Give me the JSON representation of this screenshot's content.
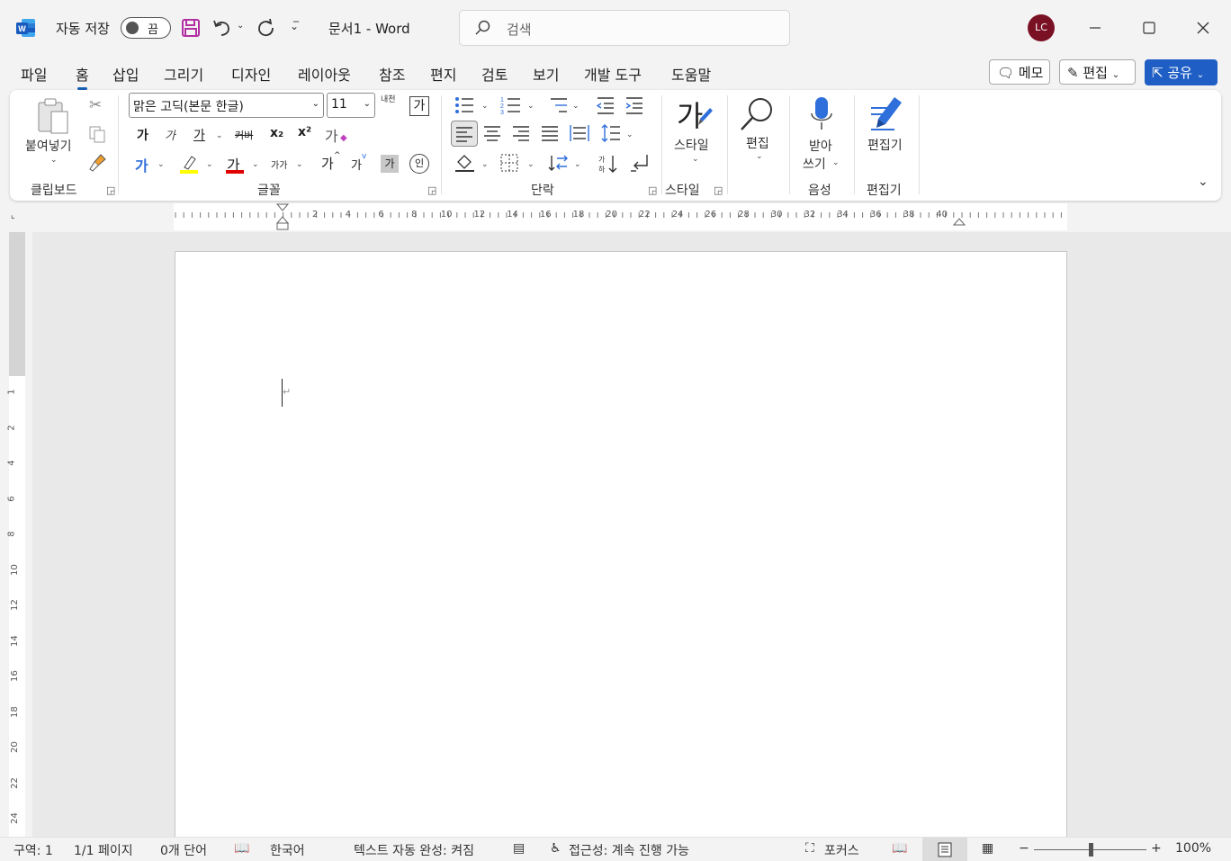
{
  "title_bar": {
    "autosave_label": "자동 저장",
    "autosave_state": "끔",
    "doc_title": "문서1  -  Word",
    "search_placeholder": "검색",
    "avatar_initials": "LC"
  },
  "tabs": [
    "파일",
    "홈",
    "삽입",
    "그리기",
    "디자인",
    "레이아웃",
    "참조",
    "편지",
    "검토",
    "보기",
    "개발 도구",
    "도움말"
  ],
  "active_tab": "홈",
  "tab_actions": {
    "memo": "메모",
    "edit": "편집",
    "share": "공유"
  },
  "ribbon": {
    "clipboard": {
      "paste": "붙여넣기",
      "label": "클립보드"
    },
    "font": {
      "font_name": "맑은 고딕(본문 한글)",
      "font_size": "11",
      "bold": "가",
      "italic": "가",
      "underline": "가",
      "strike": "커버",
      "subscript": "x₂",
      "superscript": "x²",
      "clear": "가",
      "phonetic": "내천",
      "charborder": "가",
      "texteffect": "가",
      "fontcolor": "가",
      "charscale": "가가",
      "grow": "가",
      "shrink": "가",
      "shading": "가",
      "enclose": "인",
      "label": "글꼴"
    },
    "paragraph": {
      "label": "단락"
    },
    "styles": {
      "button": "스타일",
      "label": "스타일"
    },
    "editing": {
      "button": "편집"
    },
    "voice": {
      "button": "받아\n쓰기",
      "label": "음성"
    },
    "editor": {
      "button": "편집기",
      "label": "편집기"
    },
    "colors": {
      "highlight": "#ffff00",
      "font_color": "#e00000",
      "accent": "#1f5fc5"
    }
  },
  "ruler": {
    "h_numbers": [
      "2",
      "4",
      "6",
      "8",
      "10",
      "12",
      "14",
      "16",
      "18",
      "20",
      "22",
      "24",
      "26",
      "28",
      "30",
      "32",
      "34",
      "36",
      "38",
      "40"
    ],
    "v_numbers": [
      "1",
      "2",
      "4",
      "6",
      "8",
      "10",
      "12",
      "14",
      "16",
      "18",
      "20",
      "22",
      "24"
    ]
  },
  "status": {
    "section": "구역: 1",
    "pages": "1/1 페이지",
    "words": "0개 단어",
    "language": "한국어",
    "autocomplete": "텍스트 자동 완성: 켜짐",
    "accessibility": "접근성: 계속 진행 가능",
    "focus": "포커스",
    "zoom": "100%",
    "zoom_level": 1.0
  }
}
